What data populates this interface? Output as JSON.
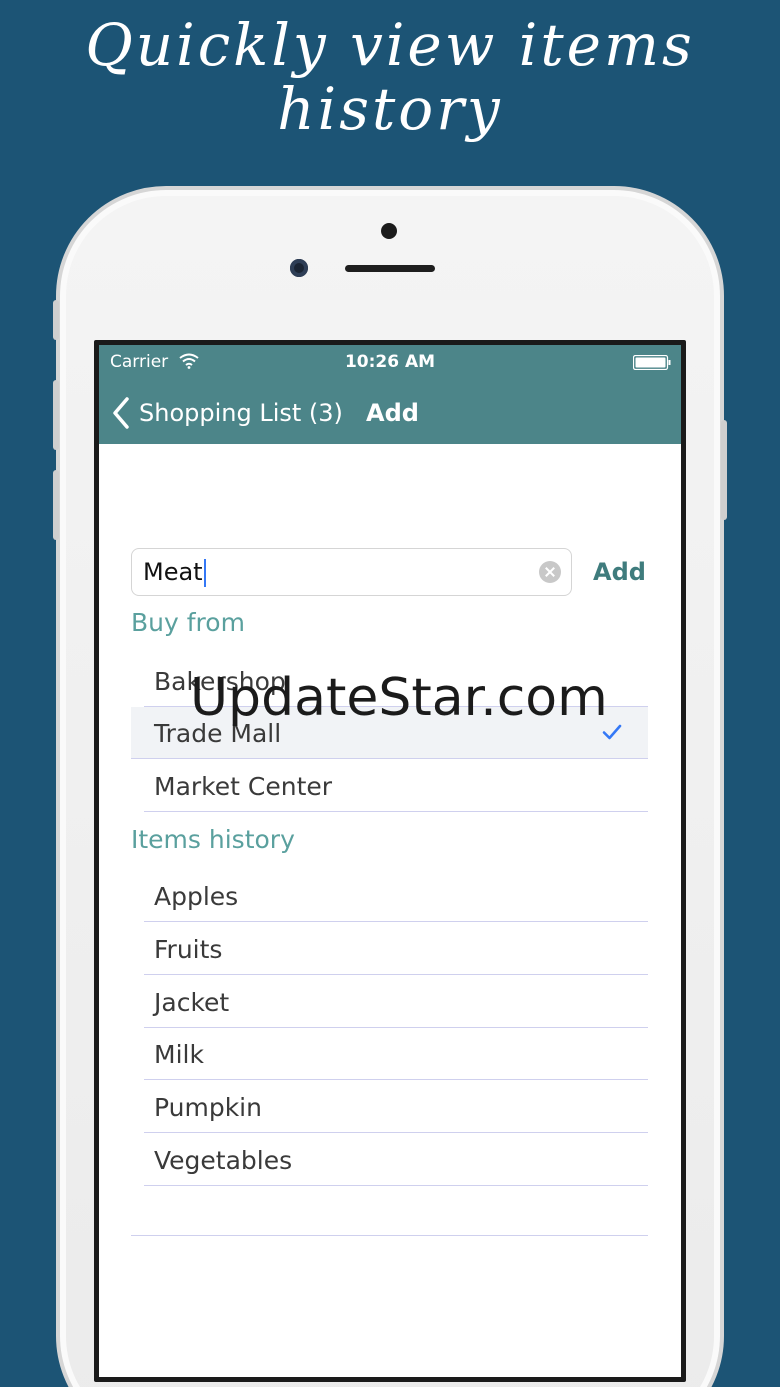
{
  "headline": {
    "line1": "Quickly view items",
    "line2": "history"
  },
  "status_bar": {
    "carrier": "Carrier",
    "time": "10:26 AM"
  },
  "nav": {
    "back_label": "Shopping List (3)",
    "title": "Add"
  },
  "search": {
    "value": "Meat",
    "add_label": "Add"
  },
  "buy_from": {
    "header": "Buy from",
    "items": [
      {
        "label": "Bakershop",
        "selected": false
      },
      {
        "label": "Trade Mall",
        "selected": true
      },
      {
        "label": "Market Center",
        "selected": false
      }
    ]
  },
  "history": {
    "header": "Items history",
    "items": [
      "Apples",
      "Fruits",
      "Jacket",
      "Milk",
      "Pumpkin",
      "Vegetables"
    ]
  },
  "watermark": "UpdateStar.com",
  "colors": {
    "background": "#1c5475",
    "navbar": "#4c8589",
    "accent": "#5aa09e",
    "check": "#3478f6"
  }
}
